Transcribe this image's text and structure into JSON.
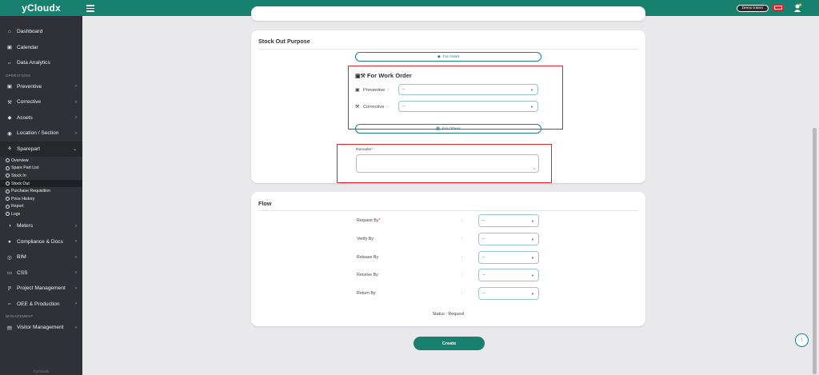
{
  "app": {
    "brand": "yCloudx",
    "footer": "©yCloudx",
    "accent_color": "#17806f",
    "highlight_color": "#e3202c"
  },
  "topbar": {
    "menu_icon": "hamburger-icon",
    "user_label": "Demo Intern",
    "flag_icon": "flag-icon",
    "notification_icon": "bell-icon"
  },
  "sidebar": {
    "main_items": [
      {
        "label": "Dashboard",
        "icon": "home-icon"
      },
      {
        "label": "Calendar",
        "icon": "calendar-icon"
      },
      {
        "label": "Data Analytics",
        "icon": "chart-icon"
      }
    ],
    "operations_label": "OPERATIONS",
    "operation_items": [
      {
        "label": "Preventive",
        "icon": "calendar-icon"
      },
      {
        "label": "Corrective",
        "icon": "wrench-icon"
      },
      {
        "label": "Assets",
        "icon": "tag-icon"
      },
      {
        "label": "Location / Section",
        "icon": "location-icon"
      },
      {
        "label": "Sparepart",
        "icon": "tools-icon"
      }
    ],
    "sparepart_sub_items": [
      {
        "label": "Overview"
      },
      {
        "label": "Spare Part List"
      },
      {
        "label": "Stock In"
      },
      {
        "label": "Stock Out"
      },
      {
        "label": "Purchase Requisition"
      },
      {
        "label": "Price History"
      },
      {
        "label": "Report"
      },
      {
        "label": "Logs"
      }
    ],
    "more_items": [
      {
        "label": "Meters",
        "icon": "gauge-icon"
      },
      {
        "label": "Compliance & Docs",
        "icon": "circle-icon"
      },
      {
        "label": "BIM",
        "icon": "globe-icon"
      },
      {
        "label": "CSS",
        "icon": "monitor-icon"
      },
      {
        "label": "Project Management",
        "icon": "project-icon"
      },
      {
        "label": "OEE & Production",
        "icon": "chart-icon"
      }
    ],
    "management_label": "MANAGEMENT",
    "management_items": [
      {
        "label": "Visitor Management",
        "icon": "id-card-icon"
      }
    ]
  },
  "stock_out_purpose": {
    "title": "Stock Out Purpose",
    "for_asset_label": "For Asset",
    "work_order_title": "For Work Order",
    "preventive_label": "Preventive",
    "preventive_value": "--",
    "corrective_label": "Corrective",
    "corrective_value": "--",
    "for_others_label": "For Others",
    "remarks_label": "Remarks",
    "remarks_required_mark": "*",
    "remarks_value": ""
  },
  "flow": {
    "title": "Flow",
    "rows": [
      {
        "label": "Request By",
        "required_mark": "*",
        "value": "--"
      },
      {
        "label": "Verify By",
        "required_mark": "",
        "value": "--"
      },
      {
        "label": "Release By",
        "required_mark": "",
        "value": "--"
      },
      {
        "label": "Receive By",
        "required_mark": "",
        "value": "--"
      },
      {
        "label": "Return By",
        "required_mark": "",
        "value": "--"
      }
    ],
    "status_text": "Status : Request"
  },
  "actions": {
    "create_label": "Create"
  }
}
